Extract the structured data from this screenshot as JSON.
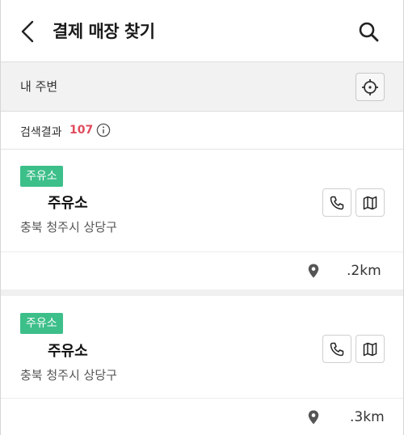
{
  "header": {
    "title": "결제 매장 찾기",
    "back_icon": "chevron-left-icon",
    "search_icon": "search-icon"
  },
  "nearby": {
    "label": "내 주변",
    "locate_icon": "crosshair-icon"
  },
  "results": {
    "label": "검색결과",
    "count": "107",
    "count_color": "#e04a5a",
    "info_icon": "info-icon"
  },
  "stores": [
    {
      "tag": "주유소",
      "name": "주유소",
      "address": "충북 청주시 상당구",
      "distance": ".2km",
      "call_icon": "phone-icon",
      "map_icon": "map-icon",
      "pin_icon": "map-pin-icon"
    },
    {
      "tag": "주유소",
      "name": "주유소",
      "address": "충북 청주시 상당구",
      "distance": ".3km",
      "call_icon": "phone-icon",
      "map_icon": "map-icon",
      "pin_icon": "map-pin-icon"
    }
  ],
  "colors": {
    "tag_green": "#3dbf8a",
    "accent_red": "#e04a5a"
  }
}
